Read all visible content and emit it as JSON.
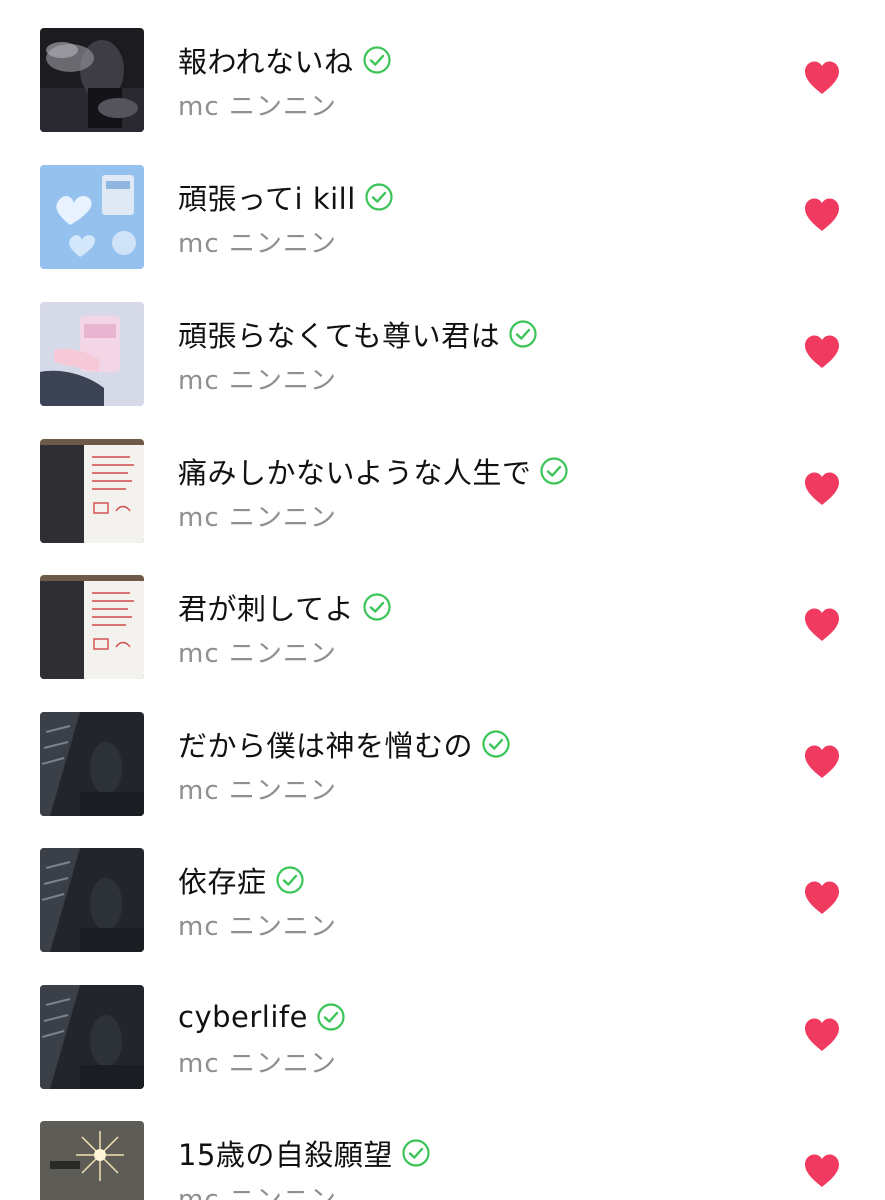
{
  "colors": {
    "title": "#111111",
    "artist": "#8e8e93",
    "check": "#3bc457",
    "heart": "#f03a5f"
  },
  "tracks": [
    {
      "title": "報われないね",
      "artist": "mc ニンニン",
      "verified_icon": "check-circle-icon",
      "like_icon": "heart-icon",
      "art": "dark-angel"
    },
    {
      "title": "頑張ってi kill",
      "artist": "mc ニンニン",
      "verified_icon": "check-circle-icon",
      "like_icon": "heart-icon",
      "art": "blue-hearts"
    },
    {
      "title": "頑張らなくても尊い君は",
      "artist": "mc ニンニン",
      "verified_icon": "check-circle-icon",
      "like_icon": "heart-icon",
      "art": "pink-hand"
    },
    {
      "title": "痛みしかないような人生で",
      "artist": "mc ニンニン",
      "verified_icon": "check-circle-icon",
      "like_icon": "heart-icon",
      "art": "notebook"
    },
    {
      "title": "君が刺してよ",
      "artist": "mc ニンニン",
      "verified_icon": "check-circle-icon",
      "like_icon": "heart-icon",
      "art": "notebook"
    },
    {
      "title": "だから僕は神を憎むの",
      "artist": "mc ニンニン",
      "verified_icon": "check-circle-icon",
      "like_icon": "heart-icon",
      "art": "dark-stairs"
    },
    {
      "title": "依存症",
      "artist": "mc ニンニン",
      "verified_icon": "check-circle-icon",
      "like_icon": "heart-icon",
      "art": "dark-stairs"
    },
    {
      "title": "cyberlife",
      "artist": "mc ニンニン",
      "verified_icon": "check-circle-icon",
      "like_icon": "heart-icon",
      "art": "dark-stairs"
    },
    {
      "title": "15歳の自殺願望",
      "artist": "mc ニンニン",
      "verified_icon": "check-circle-icon",
      "like_icon": "heart-icon",
      "art": "sparkle"
    }
  ]
}
